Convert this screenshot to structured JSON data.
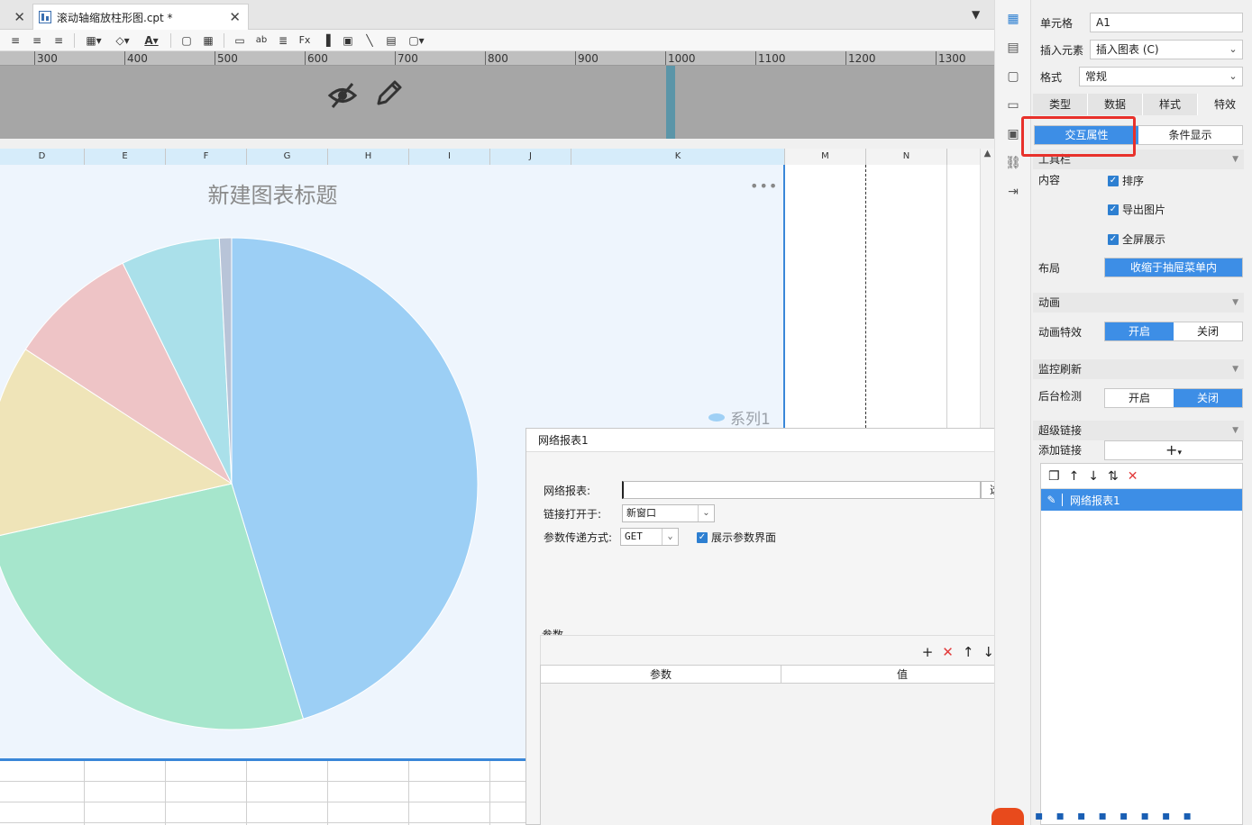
{
  "tabs": [
    {
      "label": ""
    },
    {
      "label": "滚动轴缩放柱形图.cpt *"
    }
  ],
  "ruler": [
    "300",
    "400",
    "500",
    "600",
    "700",
    "800",
    "900",
    "1000",
    "1100",
    "1200",
    "1300"
  ],
  "columns": [
    "D",
    "E",
    "F",
    "G",
    "H",
    "I",
    "J",
    "K",
    "M",
    "N"
  ],
  "chart_data": {
    "type": "pie",
    "title": "新建图表标题",
    "legend": [
      "系列1"
    ],
    "series": [
      {
        "name": "系列1",
        "values": [
          45.3,
          26.2,
          12.7,
          8.5,
          6.5,
          0.8
        ]
      }
    ],
    "colors": [
      "#9ccff5",
      "#a6e6cc",
      "#efe4b8",
      "#eec4c6",
      "#aae0ea",
      "#b8c4d8"
    ]
  },
  "dialog": {
    "title": "网络报表1",
    "report_label": "网络报表:",
    "report_value": "",
    "select_button": "选择",
    "open_in_label": "链接打开于:",
    "open_in_value": "新窗口",
    "param_method_label": "参数传递方式:",
    "param_method_value": "GET",
    "show_param_label": "展示参数界面",
    "params_title": "参数",
    "params_columns": [
      "参数",
      "值"
    ]
  },
  "panel": {
    "cell_label": "单元格",
    "cell_value": "A1",
    "insert_label": "插入元素",
    "insert_value": "插入图表 (C)",
    "format_label": "格式",
    "format_value": "常规",
    "tabs": [
      "类型",
      "数据",
      "样式",
      "特效"
    ],
    "subtabs": [
      "交互属性",
      "条件显示"
    ],
    "toolbar_section": "工具栏",
    "content_label": "内容",
    "checks": [
      "排序",
      "导出图片",
      "全屏展示"
    ],
    "layout_label": "布局",
    "layout_value": "收缩于抽屉菜单内",
    "animation_section": "动画",
    "animation_label": "动画特效",
    "on": "开启",
    "off": "关闭",
    "monitor_section": "监控刷新",
    "backend_label": "后台检测",
    "hyperlink_section": "超级链接",
    "add_link_label": "添加链接",
    "link_item": "网络报表1"
  }
}
